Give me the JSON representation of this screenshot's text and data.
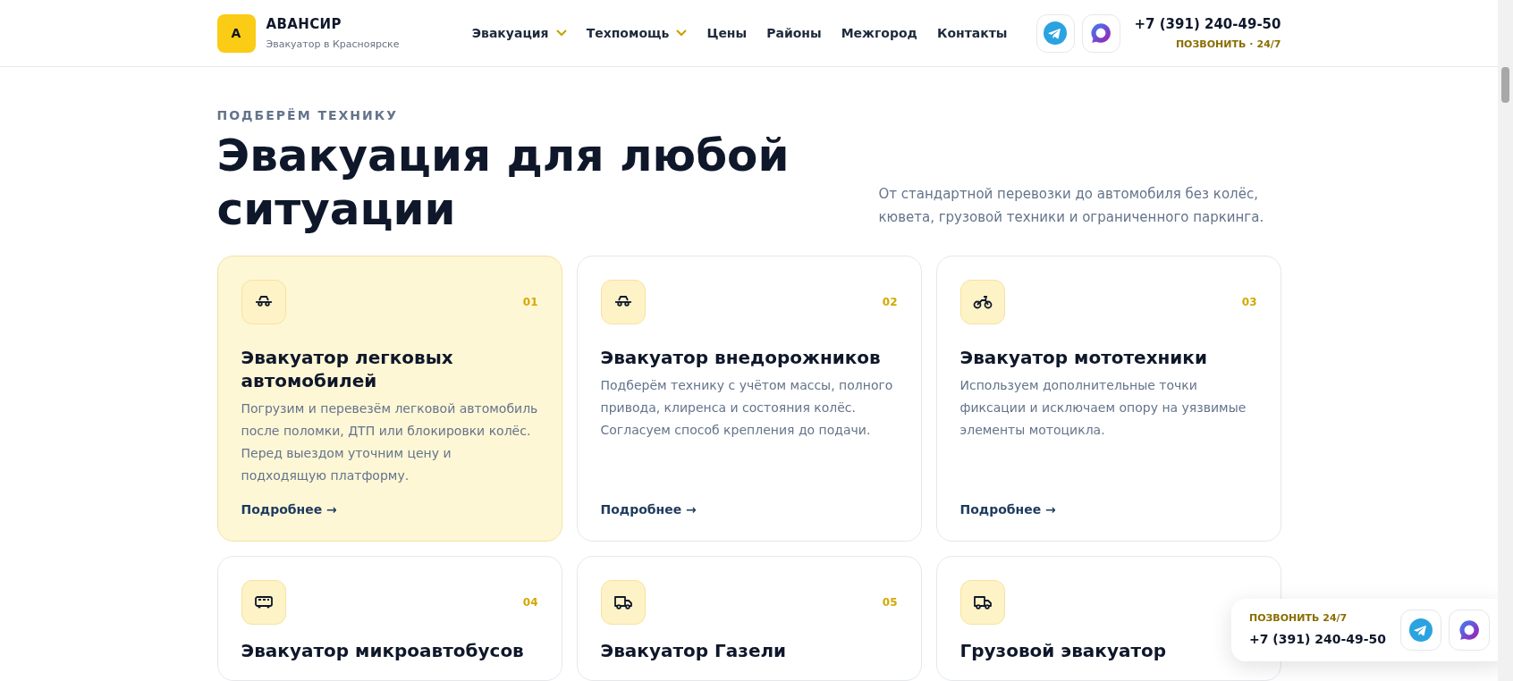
{
  "header": {
    "logo_letter": "А",
    "brand": "АВАНСИР",
    "tagline": "Эвакуатор в Красноярске",
    "nav": [
      {
        "label": "Эвакуация",
        "dropdown": true
      },
      {
        "label": "Техпомощь",
        "dropdown": true
      },
      {
        "label": "Цены",
        "dropdown": false
      },
      {
        "label": "Районы",
        "dropdown": false
      },
      {
        "label": "Межгород",
        "dropdown": false
      },
      {
        "label": "Контакты",
        "dropdown": false
      }
    ],
    "phone": "+7 (391) 240-49-50",
    "call_label": "ПОЗВОНИТЬ",
    "call_separator": "·",
    "call_hours": "24/7"
  },
  "section": {
    "eyebrow": "ПОДБЕРЁМ ТЕХНИКУ",
    "title": "Эвакуация для любой ситуации",
    "lead": "От стандартной перевозки до автомобиля без колёс, кювета, грузовой техники и ограниченного паркинга."
  },
  "cards": [
    {
      "kind": "car",
      "number": "01",
      "title": "Эвакуатор легковых автомобилей",
      "text": "Погрузим и перевезём легковой автомобиль после поломки, ДТП или блокировки колёс. Перед выездом уточним цену и подходящую платформу.",
      "link": "Подробнее →",
      "selected": true
    },
    {
      "kind": "car",
      "number": "02",
      "title": "Эвакуатор внедорожников",
      "text": "Подберём технику с учётом массы, полного привода, клиренса и состояния колёс. Согласуем способ крепления до подачи.",
      "link": "Подробнее →",
      "selected": false
    },
    {
      "kind": "moto",
      "number": "03",
      "title": "Эвакуатор мототехники",
      "text": "Используем дополнительные точки фиксации и исключаем опору на уязвимые элементы мотоцикла.",
      "link": "Подробнее →",
      "selected": false
    },
    {
      "kind": "bus",
      "number": "04",
      "title": "Эвакуатор микроавтобусов",
      "selected": false
    },
    {
      "kind": "truck",
      "number": "05",
      "title": "Эвакуатор Газели",
      "selected": false
    },
    {
      "kind": "truck",
      "title": "Грузовой эвакуатор",
      "selected": false
    }
  ],
  "float_widget": {
    "label": "ПОЗВОНИТЬ 24/7",
    "phone": "+7 (391) 240-49-50"
  }
}
